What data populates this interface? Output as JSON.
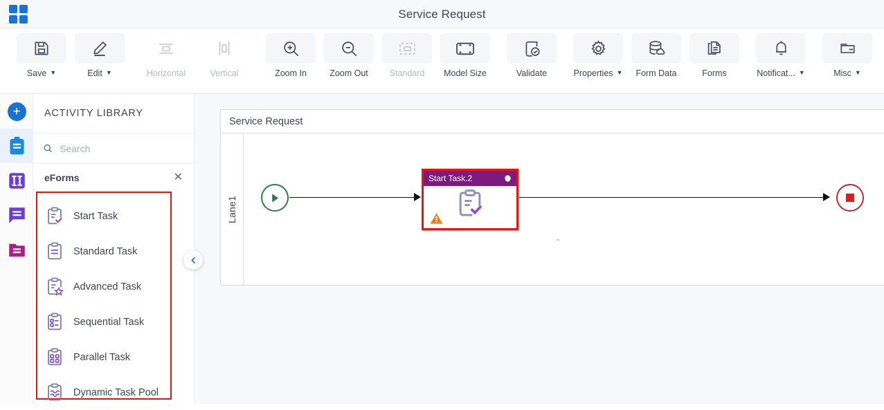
{
  "titlebar": {
    "apps_icon": "apps-grid-icon",
    "title": "Service Request"
  },
  "toolbar": {
    "items": [
      {
        "label": "Save",
        "icon": "save-icon",
        "dropdown": true,
        "disabled": false,
        "chip": true
      },
      {
        "label": "Edit",
        "icon": "edit-pencil-icon",
        "dropdown": true,
        "disabled": false,
        "chip": true
      },
      {
        "label": "Horizontal",
        "icon": "horizontal-align-icon",
        "dropdown": false,
        "disabled": true,
        "chip": true
      },
      {
        "label": "Vertical",
        "icon": "vertical-align-icon",
        "dropdown": false,
        "disabled": true,
        "chip": true
      },
      {
        "label": "Zoom In",
        "icon": "zoom-in-icon",
        "dropdown": false,
        "disabled": false,
        "chip": true
      },
      {
        "label": "Zoom Out",
        "icon": "zoom-out-icon",
        "dropdown": false,
        "disabled": false,
        "chip": true
      },
      {
        "label": "Standard",
        "icon": "standard-size-icon",
        "dropdown": false,
        "disabled": true,
        "chip": true
      },
      {
        "label": "Model Size",
        "icon": "model-size-icon",
        "dropdown": false,
        "disabled": false,
        "chip": true
      },
      {
        "label": "Validate",
        "icon": "validate-icon",
        "dropdown": false,
        "disabled": false,
        "chip": true
      },
      {
        "label": "Properties",
        "icon": "gear-icon",
        "dropdown": true,
        "disabled": false,
        "chip": true
      },
      {
        "label": "Form Data",
        "icon": "database-icon",
        "dropdown": false,
        "disabled": false,
        "chip": true
      },
      {
        "label": "Forms",
        "icon": "forms-document-icon",
        "dropdown": false,
        "disabled": false,
        "chip": true
      },
      {
        "label": "Notificat...",
        "icon": "bell-icon",
        "dropdown": true,
        "disabled": false,
        "chip": true
      },
      {
        "label": "Misc",
        "icon": "folder-icon",
        "dropdown": true,
        "disabled": false,
        "chip": true
      }
    ]
  },
  "rail": {
    "items": [
      {
        "name": "add-button",
        "icon": "plus-circle-icon",
        "active": false,
        "color": "#1a73d4"
      },
      {
        "name": "activities-button",
        "icon": "clipboard-icon",
        "active": true,
        "color": "#1a8ae0"
      },
      {
        "name": "gateways-button",
        "icon": "columns-icon",
        "active": false,
        "color": "#6b3ed4"
      },
      {
        "name": "events-button",
        "icon": "message-icon",
        "active": false,
        "color": "#6b3ed4"
      },
      {
        "name": "artifacts-button",
        "icon": "folder-list-icon",
        "active": false,
        "color": "#b01a82"
      }
    ]
  },
  "panel": {
    "title": "ACTIVITY LIBRARY",
    "search": {
      "value": "",
      "placeholder": "Search",
      "icon": "search-icon"
    },
    "group": {
      "label": "eForms",
      "close_icon": "close-icon"
    },
    "activities": [
      {
        "label": "Start Task",
        "icon": "clipboard-check-icon"
      },
      {
        "label": "Standard Task",
        "icon": "clipboard-lines-icon"
      },
      {
        "label": "Advanced Task",
        "icon": "clipboard-star-icon"
      },
      {
        "label": "Sequential Task",
        "icon": "clipboard-sequential-icon"
      },
      {
        "label": "Parallel Task",
        "icon": "clipboard-parallel-icon"
      },
      {
        "label": "Dynamic Task Pool",
        "icon": "clipboard-wave-icon"
      }
    ],
    "collapse_icon": "chevron-left-icon"
  },
  "canvas": {
    "pool_title": "Service Request",
    "lane_label": "Lane1",
    "start_node": {
      "name": "start-event",
      "icon": "play-icon",
      "color": "#2e7d46"
    },
    "end_node": {
      "name": "end-event",
      "icon": "stop-square-icon",
      "color": "#bc2b2b"
    },
    "task_node": {
      "title": "Start Task.2",
      "header_color": "#7b1b80",
      "selection_color": "#e81414",
      "gear_icon": "gear-icon",
      "body_icon": "clipboard-check-icon",
      "warning_icon": "warning-triangle-icon"
    }
  }
}
